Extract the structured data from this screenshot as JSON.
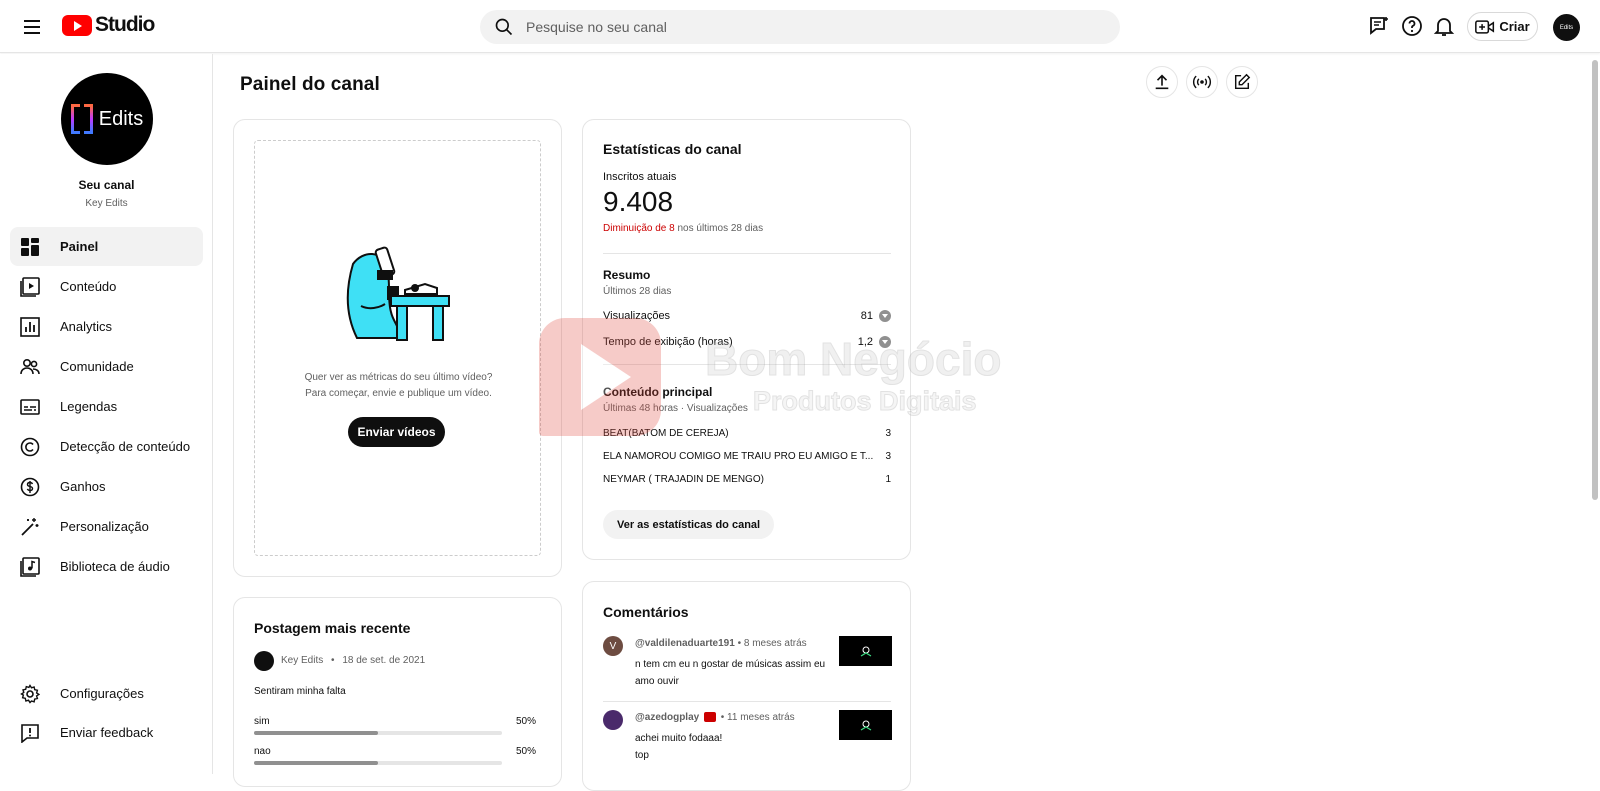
{
  "app": {
    "logo_text": "Studio",
    "search_placeholder": "Pesquise no seu canal",
    "create_label": "Criar",
    "header_icons": [
      "menu-icon",
      "search-icon",
      "feedback-chat-icon",
      "help-icon",
      "notifications-icon",
      "create-video-icon"
    ]
  },
  "sidebar": {
    "channel_title": "Seu canal",
    "channel_name": "Key Edits",
    "avatar_text": "Edits",
    "items": [
      {
        "label": "Painel",
        "icon": "dashboard-icon",
        "active": true
      },
      {
        "label": "Conteúdo",
        "icon": "content-icon"
      },
      {
        "label": "Analytics",
        "icon": "analytics-icon"
      },
      {
        "label": "Comunidade",
        "icon": "community-icon"
      },
      {
        "label": "Legendas",
        "icon": "subtitles-icon"
      },
      {
        "label": "Detecção de conteúdo",
        "icon": "copyright-icon"
      },
      {
        "label": "Ganhos",
        "icon": "dollar-icon"
      },
      {
        "label": "Personalização",
        "icon": "magic-wand-icon"
      },
      {
        "label": "Biblioteca de áudio",
        "icon": "audio-library-icon"
      }
    ],
    "bottom_items": [
      {
        "label": "Configurações",
        "icon": "gear-icon"
      },
      {
        "label": "Enviar feedback",
        "icon": "feedback-icon"
      }
    ]
  },
  "main": {
    "title": "Painel do canal",
    "action_icons": [
      "upload-icon",
      "live-icon",
      "edit-post-icon"
    ],
    "upload_card": {
      "line1": "Quer ver as métricas do seu último vídeo?",
      "line2": "Para começar, envie e publique um vídeo.",
      "button": "Enviar vídeos"
    },
    "stats": {
      "title": "Estatísticas do canal",
      "subs_label": "Inscritos atuais",
      "subs_value": "9.408",
      "subs_change_red": "Diminuição de 8",
      "subs_change_rest": " nos últimos 28 dias",
      "summary_title": "Resumo",
      "summary_period": "Últimos 28 dias",
      "rows": [
        {
          "label": "Visualizações",
          "value": "81"
        },
        {
          "label": "Tempo de exibição (horas)",
          "value": "1,2"
        }
      ],
      "top_title": "Conteúdo principal",
      "top_period": "Últimas 48 horas · Visualizações",
      "top_items": [
        {
          "label": "BEAT(BATOM DE CEREJA)",
          "value": "3"
        },
        {
          "label": "ELA NAMOROU COMIGO ME TRAIU PRO EU AMIGO E T...",
          "value": "3"
        },
        {
          "label": "NEYMAR ( TRAJADIN DE MENGO)",
          "value": "1"
        }
      ],
      "button": "Ver as estatísticas do canal"
    },
    "post": {
      "title": "Postagem mais recente",
      "author": "Key Edits",
      "date": "18 de set. de 2021",
      "text": "Sentiram minha falta",
      "options": [
        {
          "label": "sim",
          "pct": "50%",
          "fraction": 0.5
        },
        {
          "label": "nao",
          "pct": "50%",
          "fraction": 0.5
        }
      ]
    },
    "comments": {
      "title": "Comentários",
      "items": [
        {
          "user": "@valdilenaduarte191",
          "time": "• 8 meses atrás",
          "text": "n tem cm eu n gostar de músicas assim eu amo ouvir",
          "avatar_letter": "V",
          "avatar_color": "#6d4c41"
        },
        {
          "user": "@azedogplay",
          "time": "• 11 meses atrás",
          "text": "achei muito fodaaa!\ntop",
          "avatar_letter": "",
          "avatar_color": "#4a2a6b"
        }
      ]
    }
  },
  "watermark": {
    "title": "Bom Negócio",
    "subtitle": "Produtos Digitais"
  },
  "colors": {
    "accent_red": "#ff0000",
    "decrease_red": "#cc0000",
    "text": "#0f0f0f",
    "muted": "#606060"
  }
}
